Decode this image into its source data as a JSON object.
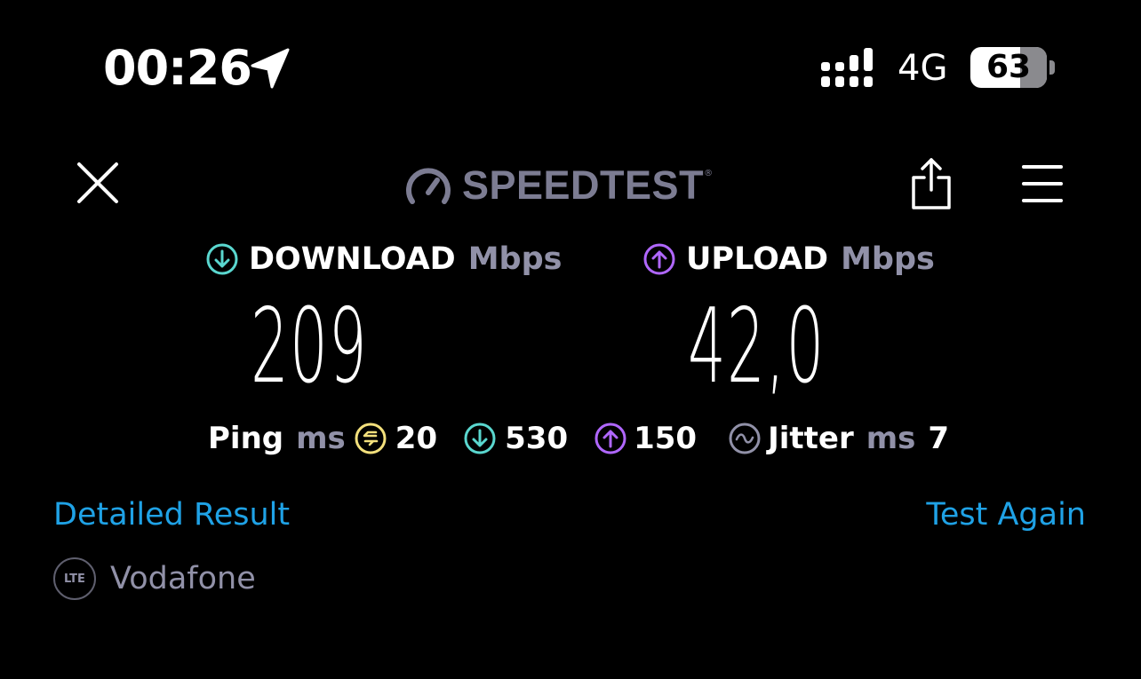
{
  "status_bar": {
    "time": "00:26",
    "network": "4G",
    "battery": "63",
    "icons": [
      "location-arrow-icon",
      "signal-bars-icon",
      "battery-icon"
    ]
  },
  "header": {
    "logo_text": "SPEEDTEST",
    "logo_tm": "®",
    "icons": [
      "close-icon",
      "speedometer-logo-icon",
      "share-icon",
      "menu-icon"
    ]
  },
  "download": {
    "label": "DOWNLOAD",
    "unit": "Mbps",
    "value": "209",
    "icon": "download-arrow-icon",
    "color": "#5ad7cf"
  },
  "upload": {
    "label": "UPLOAD",
    "unit": "Mbps",
    "value": "42,0",
    "icon": "upload-arrow-icon",
    "color": "#b067ff"
  },
  "ping": {
    "label": "Ping",
    "unit": "ms",
    "idle_value": "20",
    "download_value": "530",
    "upload_value": "150",
    "idle_color": "#f3e07c",
    "jitter_label": "Jitter",
    "jitter_unit": "ms",
    "jitter_value": "7"
  },
  "links": {
    "detailed": "Detailed Result",
    "test_again": "Test Again",
    "color": "#1fa2e6"
  },
  "carrier": {
    "badge": "LTE",
    "name": "Vodafone"
  }
}
